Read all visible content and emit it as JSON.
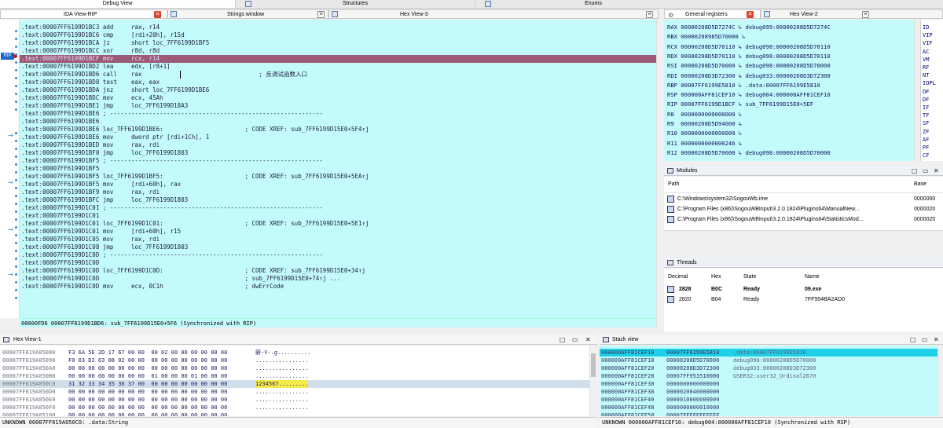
{
  "top_tabs": [
    {
      "label": "Debug View"
    },
    {
      "label": "Structures"
    },
    {
      "label": "Enums"
    }
  ],
  "left_tabs": [
    {
      "label": "IDA View-RIP"
    },
    {
      "label": "Strings window"
    },
    {
      "label": "Hex View-3"
    }
  ],
  "right_tabs": [
    {
      "label": "General registers"
    },
    {
      "label": "Hex View-2"
    }
  ],
  "disasm": {
    "rip_label": "RIP",
    "lines": [
      ".text:00007FF6199D1BC3 add     rax, r14",
      ".text:00007FF6199D1BC6 cmp     [rdi+20h], r15d",
      ".text:00007FF6199D1BCA jz      short loc_7FF6199D1BF5",
      ".text:00007FF6199D1BCC xor     r8d, r8d",
      ".text:00007FF6199D1BCF mov     rcx, r14",
      ".text:00007FF6199D1BD2 lea     edx, [r8+1]",
      ".text:00007FF6199D1BD6 call    rax                                 ; 反调试函数入口",
      ".text:00007FF6199D1BD8 test    eax, eax",
      ".text:00007FF6199D1BDA jnz     short loc_7FF6199D1BE6",
      ".text:00007FF6199D1BDC mov     ecx, 45Ah",
      ".text:00007FF6199D1BE1 jmp     loc_7FF6199D18A3",
      ".text:00007FF6199D1BE6 ; ------------------------------------------------------------",
      ".text:00007FF6199D1BE6",
      ".text:00007FF6199D1BE6 loc_7FF6199D1BE6:                       ; CODE XREF: sub_7FF6199D15E0+5F4↑j",
      ".text:00007FF6199D1BE6 mov     dword ptr [rdi+1Ch], 1",
      ".text:00007FF6199D1BED mov     rax, rdi",
      ".text:00007FF6199D1BF0 jmp     loc_7FF6199D1803",
      ".text:00007FF6199D1BF5 ; ------------------------------------------------------------",
      ".text:00007FF6199D1BF5",
      ".text:00007FF6199D1BF5 loc_7FF6199D1BF5:                       ; CODE XREF: sub_7FF6199D15E0+5EA↑j",
      ".text:00007FF6199D1BF5 mov     [rdi+60h], rax",
      ".text:00007FF6199D1BF9 mov     rax, rdi",
      ".text:00007FF6199D1BFC jmp     loc_7FF6199D1803",
      ".text:00007FF6199D1C01 ; ------------------------------------------------------------",
      ".text:00007FF6199D1C01",
      ".text:00007FF6199D1C01 loc_7FF6199D1C01:                       ; CODE XREF: sub_7FF6199D15E0+5E1↑j",
      ".text:00007FF6199D1C01 mov     [rdi+60h], r15",
      ".text:00007FF6199D1C05 mov     rax, rdi",
      ".text:00007FF6199D1C08 jmp     loc_7FF6199D1803",
      ".text:00007FF6199D1C0D ; ------------------------------------------------------------",
      ".text:00007FF6199D1C0D",
      ".text:00007FF6199D1C0D loc_7FF6199D1C0D:                       ; CODE XREF: sub_7FF6199D15E0+34↑j",
      ".text:00007FF6199D1C0D                                         ; sub_7FF6199D15E0+74↑j ...",
      ".text:00007FF6199D1C0D mov     ecx, 0C1h                       ; dwErrCode"
    ],
    "status": "00000FD6 00007FF6199D1BD6: sub_7FF6199D15E0+5F6 (Synchronized with RIP)"
  },
  "registers": [
    "RAX 00000208D5D7274C ↳ debug099:00000208D5D7274C",
    "RBX 00000208985D70000 ↳",
    "RCX 00000208D5D70110 ↳ debug098:00000208D5D70110",
    "RDX 00000208D5D70110 ↳ debug098:00000208D5D70110",
    "RSI 00000208D5D70000 ↳ debug098:00000208D5D70000",
    "RDI 00000208D3D72300 ↳ debug033:00000208D3D72300",
    "RBP 00007FF6199E5810 ↳ .data:00007FF6199E5810",
    "RSP 000000AFF81CEF10 ↳ debug004:000000AFF81CEF10",
    "RIP 00007FF6199D1BCF ↳ sub_7FF6199D15E0+5EF",
    "R8  0000000000000000 ↳",
    "R9  00000208D5D94000 ↳",
    "R10 0000000000000000 ↳",
    "R11 0000000000000246 ↳",
    "R12 00000208D5D70000 ↳ debug098:00000208D5D70000"
  ],
  "flags": [
    "ID",
    "VIP",
    "VIF",
    "AC",
    "VM",
    "RF",
    "NT",
    "IOPL",
    "OF",
    "DF",
    "IF",
    "TF",
    "SF",
    "ZF",
    "AF",
    "PF",
    "CF"
  ],
  "modules": {
    "title": "Modules",
    "col_path": "Path",
    "col_base": "Base",
    "rows": [
      {
        "path": "C:\\Windows\\system32\\SogouWb.ime",
        "base": "0000000"
      },
      {
        "path": "C:\\Program Files (x86)\\SogouWBInput\\3.2.0.1824\\Plugins64\\ManualNew...",
        "base": "0000020"
      },
      {
        "path": "C:\\Program Files (x86)\\SogouWBInput\\3.2.0.1824\\Plugins64\\StatisticsMod...",
        "base": "0000020"
      }
    ]
  },
  "threads": {
    "title": "Threads",
    "cols": [
      "Decimal",
      "Hex",
      "State",
      "Name"
    ],
    "rows": [
      {
        "dec": "2828",
        "hex": "B0C",
        "state": "Ready",
        "name": "09.exe"
      },
      {
        "dec": "2820",
        "hex": "B04",
        "state": "Ready",
        "name": "7FF954BA2AD0"
      }
    ]
  },
  "hexview": {
    "title": "Hex View-1",
    "rows": [
      {
        "addr": "00007FF619A05080",
        "bytes": "F3 6A 5E 2D 17 67 00 00  00 02 00 00 00 00 00 00",
        "ascii": "簖-V-.g.........."
      },
      {
        "addr": "00007FF619A05090",
        "bytes": "F0 03 D2 03 08 02 00 00  00 00 00 00 00 00 00 00",
        "ascii": "................"
      },
      {
        "addr": "00007FF619A050A0",
        "bytes": "00 00 00 00 00 00 00 00  00 00 00 00 00 00 00 00",
        "ascii": "................"
      },
      {
        "addr": "00007FF619A050B0",
        "bytes": "00 00 00 00 00 00 00 00  01 00 00 00 01 00 00 00",
        "ascii": "................"
      },
      {
        "addr": "00007FF619A050C0",
        "bytes": "31 32 33 34 35 36 37 00  00 00 00 00 00 00 00 00",
        "ascii": "1234567........."
      },
      {
        "addr": "00007FF619A050D0",
        "bytes": "00 00 00 00 00 00 00 00  00 00 00 00 00 00 00 00",
        "ascii": "................"
      },
      {
        "addr": "00007FF619A050E0",
        "bytes": "00 00 00 00 00 00 00 00  00 00 00 00 00 00 00 00",
        "ascii": "................"
      },
      {
        "addr": "00007FF619A050F0",
        "bytes": "00 00 00 00 00 00 00 00  00 00 00 00 00 00 00 00",
        "ascii": "................"
      },
      {
        "addr": "00007FF619A05100",
        "bytes": "00 00 00 00 00 00 00 00  00 00 00 00 00 00 00 00",
        "ascii": "................"
      },
      {
        "addr": "00007FF619A05110",
        "bytes": "00 00 00 00 00 00 00 00  00 00 00 00 00 00 00 00",
        "ascii": "................"
      },
      {
        "addr": "00007FF619A05120",
        "bytes": "00 00 00 00 00 00 00 00  00 00 00 00 00 00 00 00",
        "ascii": "................"
      }
    ],
    "status": "UNKNOWN 00007FF619A050C0: .data:String"
  },
  "stack": {
    "title": "Stack view",
    "rows": [
      {
        "addr": "000000AFF81CEF10",
        "val": "00007FF6199E5810",
        "cmt": ".data:00007FF6199E5810"
      },
      {
        "addr": "000000AFF81CEF18",
        "val": "00000208D5D70000",
        "cmt": "debug098:00000208D5D70000"
      },
      {
        "addr": "000000AFF81CEF20",
        "val": "00000208D3D72300",
        "cmt": "debug033:00000208D3D72300"
      },
      {
        "addr": "000000AFF81CEF28",
        "val": "00007FF953510000",
        "cmt": "USER32:user32_Ordinal2670"
      },
      {
        "addr": "000000AFF81CEF30",
        "val": "0000000000000000",
        "cmt": ""
      },
      {
        "addr": "000000AFF81CEF38",
        "val": "0000020840000000",
        "cmt": ""
      },
      {
        "addr": "000000AFF81CEF40",
        "val": "0000010000000009",
        "cmt": ""
      },
      {
        "addr": "000000AFF81CEF48",
        "val": "0000000000010000",
        "cmt": ""
      },
      {
        "addr": "000000AFF81CEF50",
        "val": "00007FFFFFFEFFFF",
        "cmt": ""
      },
      {
        "addr": "000000AFF81CEF58",
        "val": "000000000000000F",
        "cmt": ""
      },
      {
        "addr": "000000AFF81CEF60",
        "val": "0000021D80000004",
        "cmt": ""
      }
    ],
    "status": "UNKNOWN 000000AFF81CEF10: debug004:000000AFF81CEF10 (Synchronized with RSP)"
  },
  "colors": {
    "code_bg": "#c3fbfb",
    "highlight": "#9c5a76",
    "accent": "#2a8ae0"
  }
}
